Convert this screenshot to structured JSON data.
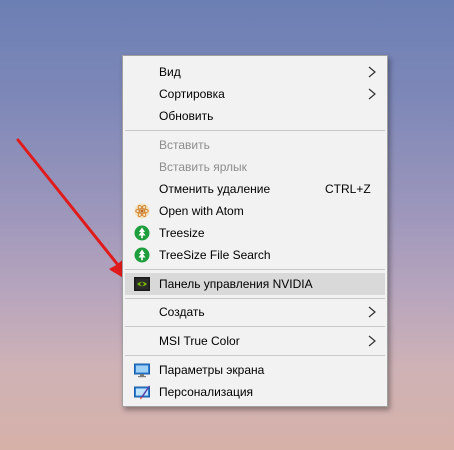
{
  "menu": {
    "items": [
      {
        "label": "Вид",
        "icon": "none",
        "submenu": true
      },
      {
        "label": "Сортировка",
        "icon": "none",
        "submenu": true
      },
      {
        "label": "Обновить",
        "icon": "none"
      },
      {
        "label": "Вставить",
        "icon": "none",
        "disabled": true
      },
      {
        "label": "Вставить ярлык",
        "icon": "none",
        "disabled": true
      },
      {
        "label": "Отменить удаление",
        "icon": "none",
        "shortcut": "CTRL+Z"
      },
      {
        "label": "Open with Atom",
        "icon": "atom-icon"
      },
      {
        "label": "Treesize",
        "icon": "treesize-icon"
      },
      {
        "label": "TreeSize File Search",
        "icon": "treesize-icon"
      },
      {
        "label": "Панель управления NVIDIA",
        "icon": "nvidia-icon",
        "highlighted": true
      },
      {
        "label": "Создать",
        "icon": "none",
        "submenu": true
      },
      {
        "label": "MSI True Color",
        "icon": "none",
        "submenu": true
      },
      {
        "label": "Параметры экрана",
        "icon": "display-settings-icon"
      },
      {
        "label": "Персонализация",
        "icon": "personalization-icon"
      }
    ]
  },
  "colors": {
    "annotation_arrow": "#e01b1b",
    "menu_background": "#f2f2f2",
    "highlight": "#d9d9d9",
    "disabled_text": "#8d8d8d",
    "nvidia_green": "#76b900",
    "treesize_green": "#1e9e3c"
  }
}
